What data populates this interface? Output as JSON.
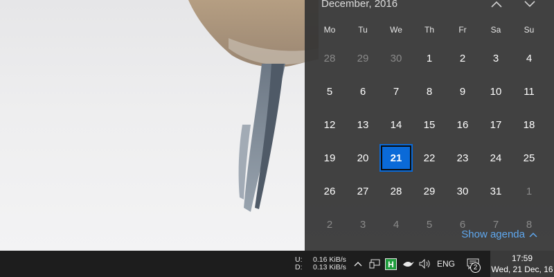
{
  "calendar": {
    "month_label": "December, 2016",
    "weekdays": [
      "Mo",
      "Tu",
      "We",
      "Th",
      "Fr",
      "Sa",
      "Su"
    ],
    "days": [
      {
        "d": "28",
        "dim": true
      },
      {
        "d": "29",
        "dim": true
      },
      {
        "d": "30",
        "dim": true
      },
      {
        "d": "1"
      },
      {
        "d": "2"
      },
      {
        "d": "3"
      },
      {
        "d": "4"
      },
      {
        "d": "5"
      },
      {
        "d": "6"
      },
      {
        "d": "7"
      },
      {
        "d": "8"
      },
      {
        "d": "9"
      },
      {
        "d": "10"
      },
      {
        "d": "11"
      },
      {
        "d": "12"
      },
      {
        "d": "13"
      },
      {
        "d": "14"
      },
      {
        "d": "15"
      },
      {
        "d": "16"
      },
      {
        "d": "17"
      },
      {
        "d": "18"
      },
      {
        "d": "19"
      },
      {
        "d": "20"
      },
      {
        "d": "21",
        "today": true
      },
      {
        "d": "22"
      },
      {
        "d": "23"
      },
      {
        "d": "24"
      },
      {
        "d": "25"
      },
      {
        "d": "26"
      },
      {
        "d": "27"
      },
      {
        "d": "28"
      },
      {
        "d": "29"
      },
      {
        "d": "30"
      },
      {
        "d": "31"
      },
      {
        "d": "1",
        "dim": true
      },
      {
        "d": "2",
        "dim": true
      },
      {
        "d": "3",
        "dim": true
      },
      {
        "d": "4",
        "dim": true
      },
      {
        "d": "5",
        "dim": true
      },
      {
        "d": "6",
        "dim": true
      },
      {
        "d": "7",
        "dim": true
      },
      {
        "d": "8",
        "dim": true
      }
    ],
    "agenda_label": "Show agenda",
    "accent": "#0a6ad8",
    "link_color": "#5fa8ef"
  },
  "taskbar": {
    "upload_label": "U:",
    "upload_value": "0.16 KiB/s",
    "download_label": "D:",
    "download_value": "0.13 KiB/s",
    "hw_icon_text": "H",
    "language": "ENG",
    "notification_count": "2",
    "time": "17:59",
    "date": "Wed, 21 Dec, 16"
  }
}
